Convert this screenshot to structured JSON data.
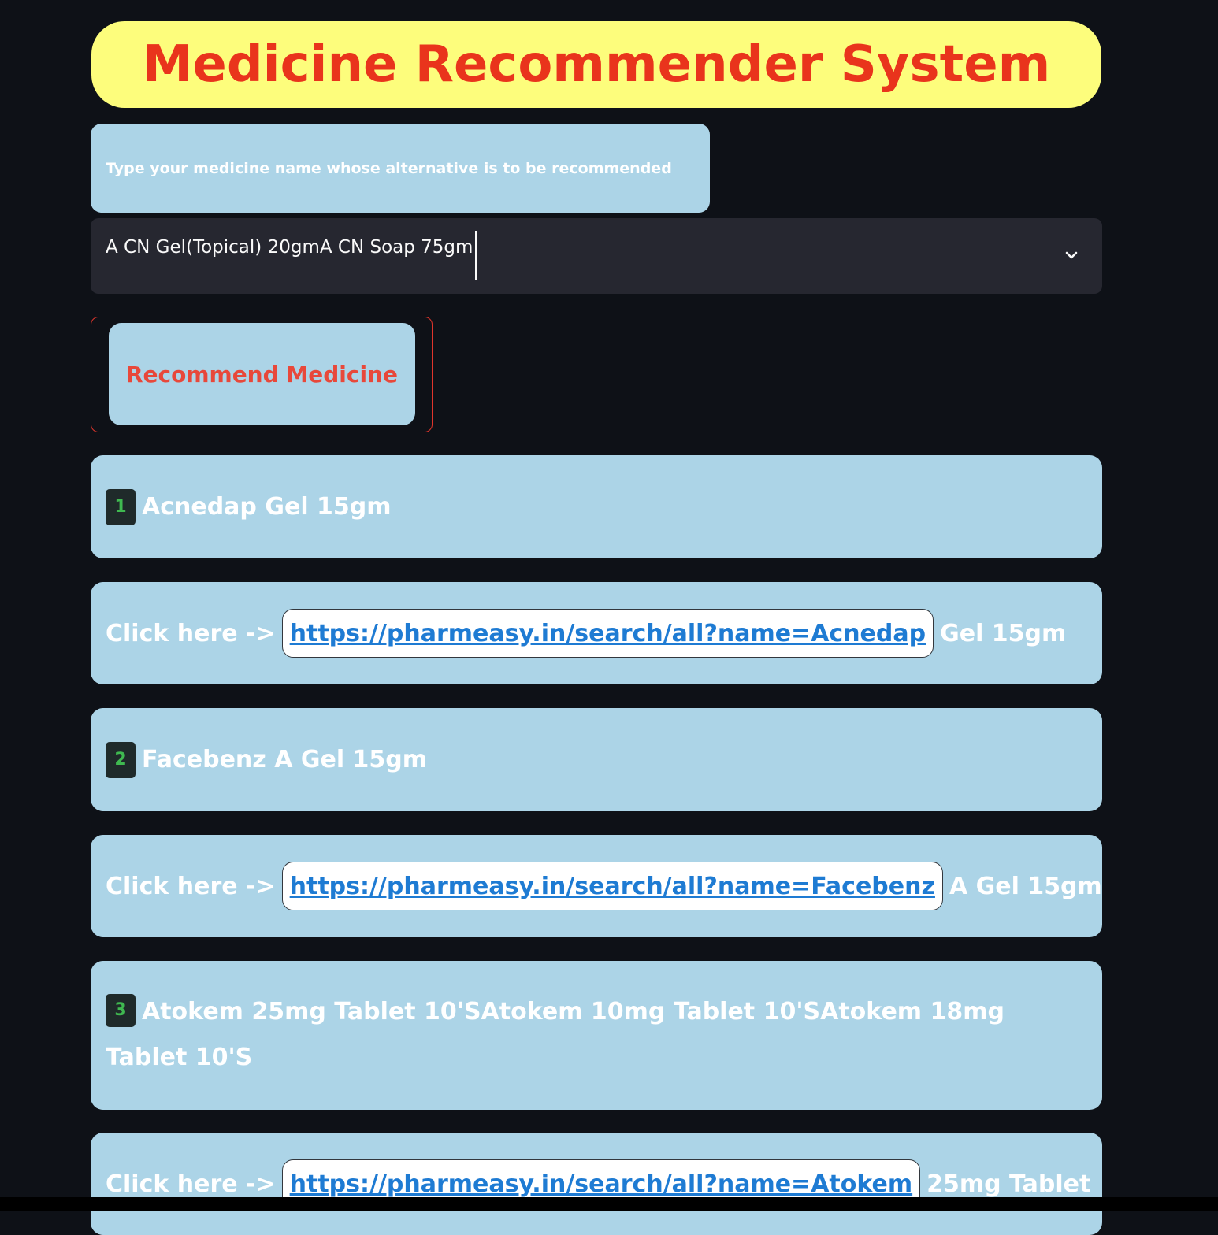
{
  "title": "Medicine Recommender System",
  "prompt_label": "Type your medicine name whose alternative is to be recommended",
  "select": {
    "value": "A CN Gel(Topical) 20gmA CN Soap 75gm"
  },
  "recommend_button": "Recommend Medicine",
  "results": [
    {
      "number": "1",
      "name": "Acnedap Gel 15gm",
      "click_prefix": "Click here ->",
      "url": "https://pharmeasy.in/search/all?name=Acnedap",
      "url_suffix": "Gel 15gm"
    },
    {
      "number": "2",
      "name": "Facebenz A Gel 15gm",
      "click_prefix": "Click here ->",
      "url": "https://pharmeasy.in/search/all?name=Facebenz",
      "url_suffix": "A Gel 15gm"
    },
    {
      "number": "3",
      "name": "Atokem 25mg Tablet 10'SAtokem 10mg Tablet 10'SAtokem 18mg Tablet 10'S",
      "click_prefix": "Click here ->",
      "url": "https://pharmeasy.in/search/all?name=Atokem",
      "url_suffix": "25mg Tablet"
    }
  ],
  "colors": {
    "background": "#0e1117",
    "banner": "#fdfd7c",
    "title_text": "#e9341c",
    "card": "#acd4e7",
    "link": "#1e7bd3",
    "badge_number": "#3fb950"
  },
  "icons": {
    "select_toggle": "chevron-down-icon"
  }
}
